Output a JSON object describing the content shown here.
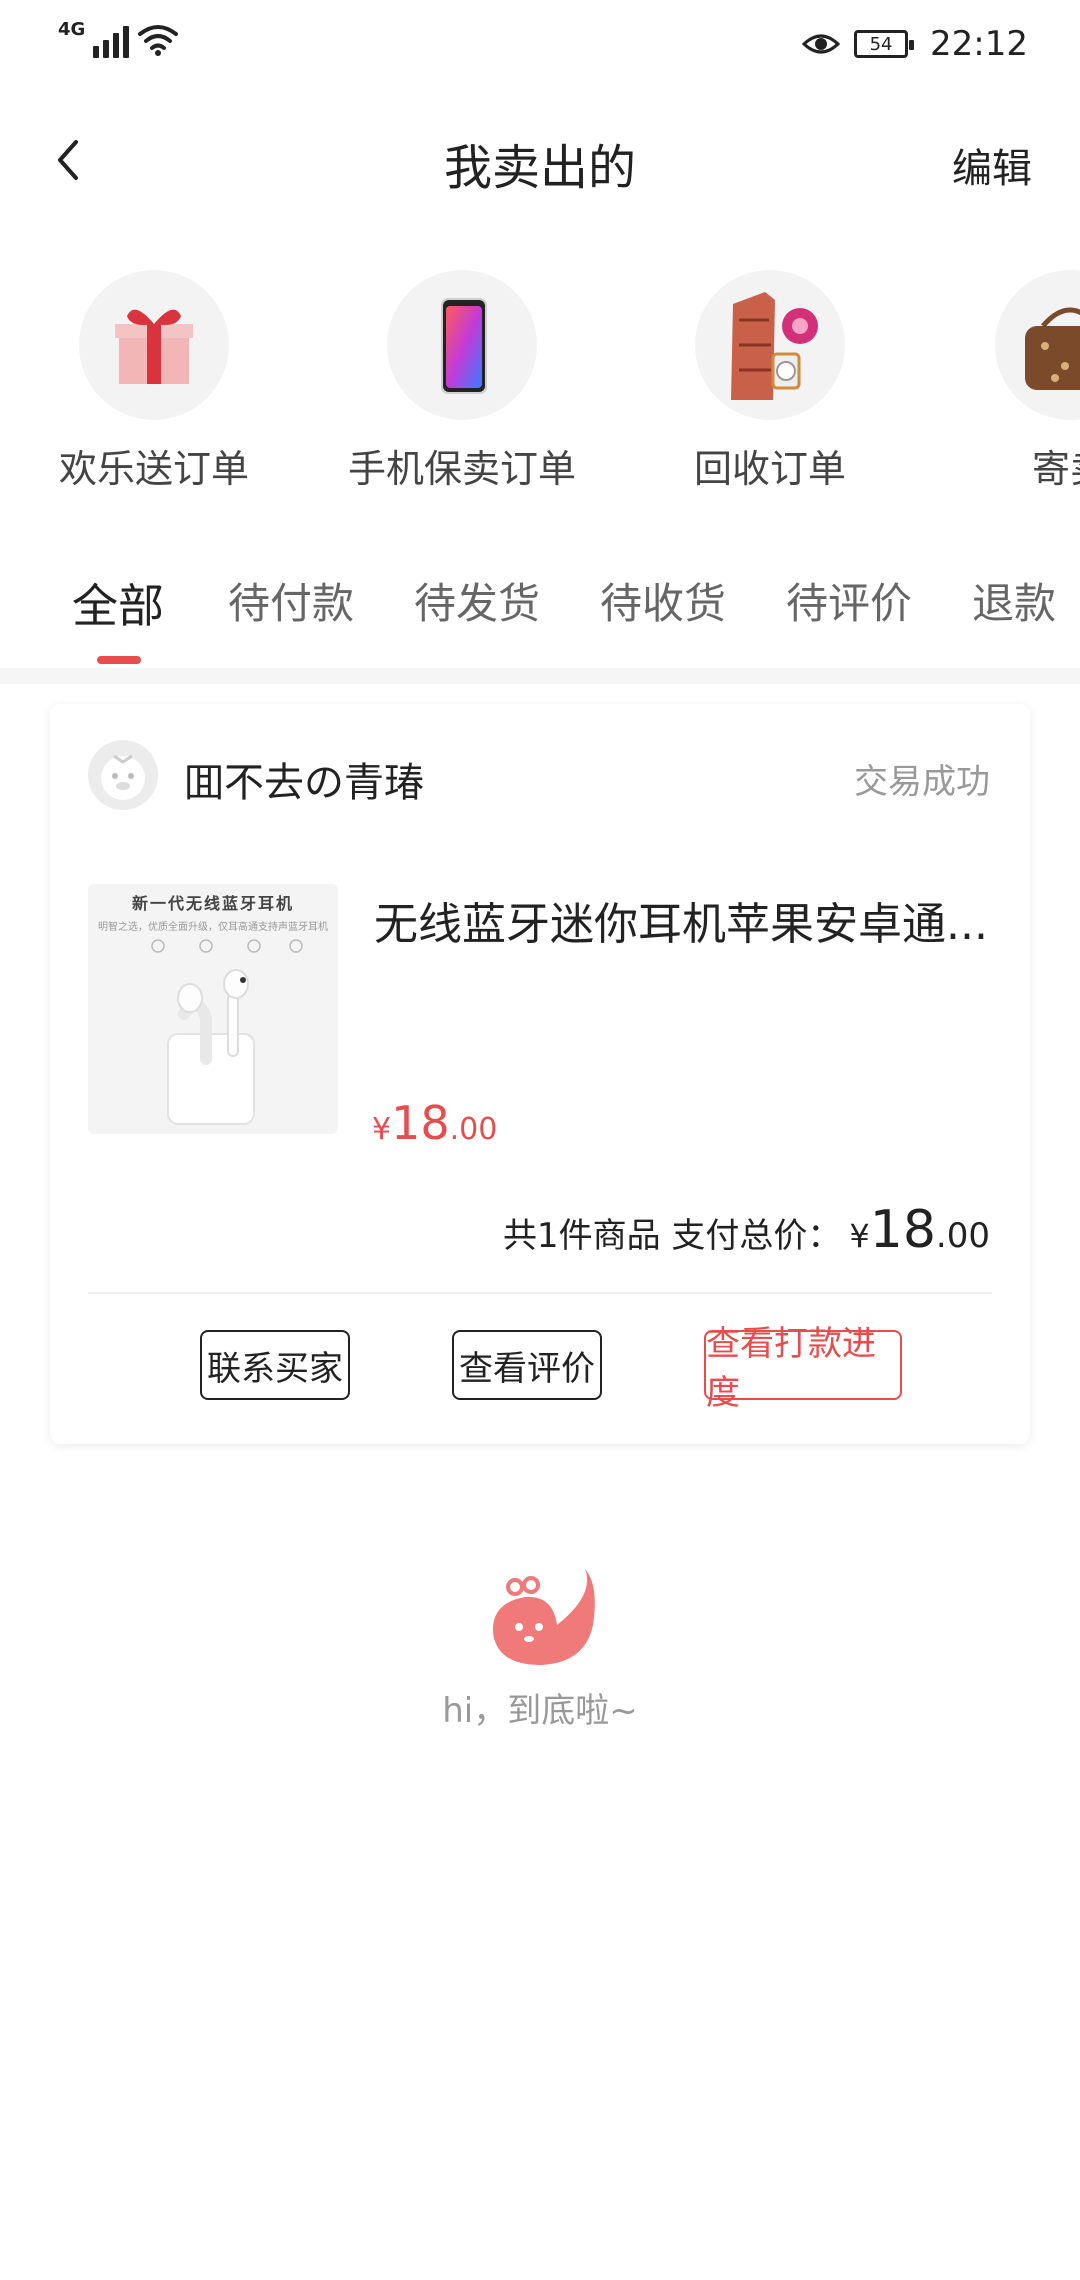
{
  "status_bar": {
    "network": "4G",
    "battery": "54",
    "time": "22:12"
  },
  "nav": {
    "title": "我卖出的",
    "edit": "编辑",
    "back_icon": "chevron-left-icon"
  },
  "categories": [
    {
      "label": "欢乐送订单",
      "icon": "gift-icon"
    },
    {
      "label": "手机保卖订单",
      "icon": "phone-icon"
    },
    {
      "label": "回收订单",
      "icon": "clothes-icon"
    },
    {
      "label": "寄卖",
      "icon": "bag-icon"
    }
  ],
  "tabs": [
    "全部",
    "待付款",
    "待发货",
    "待收货",
    "待评价",
    "退款"
  ],
  "active_tab": "全部",
  "order": {
    "shop_name": "囬不去の青瑃",
    "status": "交易成功",
    "product": {
      "thumb_title": "新一代无线蓝牙耳机",
      "thumb_subtitle": "明智之选，优质全面升级，仅耳高通支持声蓝牙耳机",
      "title": "无线蓝牙迷你耳机苹果安卓通...",
      "price_currency": "¥",
      "price_int": "18",
      "price_dec": ".00"
    },
    "total_label": "共1件商品 支付总价：",
    "total_currency": "¥",
    "total_int": "18",
    "total_dec": ".00",
    "buttons": {
      "contact": "联系买家",
      "review": "查看评价",
      "progress": "查看打款进度"
    }
  },
  "footer": {
    "text": "hi，到底啦~"
  },
  "colors": {
    "accent": "#e84d4d",
    "text": "#222222",
    "muted": "#999999"
  }
}
